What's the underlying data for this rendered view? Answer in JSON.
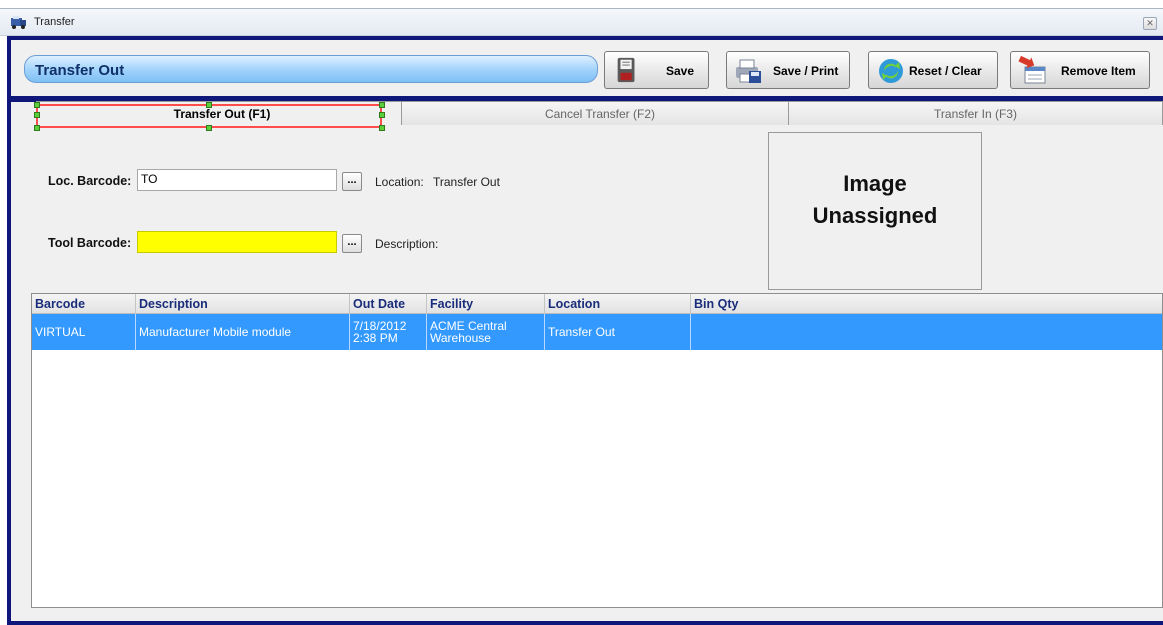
{
  "window": {
    "title": "Transfer",
    "close_glyph": "✕"
  },
  "header": {
    "module_title": "Transfer Out",
    "buttons": {
      "save": "Save",
      "save_print": "Save / Print",
      "reset_clear": "Reset / Clear",
      "remove_item": "Remove Item"
    }
  },
  "tabs": [
    {
      "label": "Transfer Out (F1)",
      "active": true
    },
    {
      "label": "Cancel Transfer (F2)",
      "active": false
    },
    {
      "label": "Transfer In (F3)",
      "active": false
    }
  ],
  "form": {
    "loc_barcode_label": "Loc. Barcode:",
    "loc_barcode_value": "TO",
    "browse_label": "...",
    "location_label": "Location:",
    "location_value": "Transfer Out",
    "tool_barcode_label": "Tool Barcode:",
    "tool_barcode_value": "",
    "description_label": "Description:"
  },
  "image_box": {
    "line1": "Image",
    "line2": "Unassigned"
  },
  "grid": {
    "columns": [
      "Barcode",
      "Description",
      "Out Date",
      "Facility",
      "Location",
      "Bin Qty"
    ],
    "rows": [
      {
        "barcode": "VIRTUAL",
        "description": "Manufacturer Mobile module",
        "out_date_line1": "7/18/2012",
        "out_date_line2": "2:38 PM",
        "facility_line1": "ACME Central",
        "facility_line2": "Warehouse",
        "location": "Transfer Out",
        "bin_qty": ""
      }
    ]
  },
  "colors": {
    "frame": "#10177a",
    "selection": "#3399ff",
    "tool_field": "#ffff00",
    "header_text": "#1a2d7a"
  }
}
